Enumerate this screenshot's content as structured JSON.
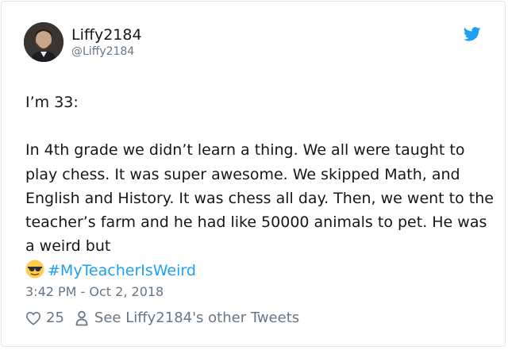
{
  "author": {
    "display_name": "Liffy2184",
    "handle": "@Liffy2184"
  },
  "icons": {
    "platform": "twitter-bird-icon",
    "like": "heart-icon",
    "profile": "person-icon",
    "emoji": "sunglasses-smiley-emoji"
  },
  "colors": {
    "accent": "#1da1f2",
    "text": "#14171a",
    "muted": "#657786"
  },
  "tweet": {
    "intro": "I’m 33:",
    "body": "In 4th grade we didn’t learn a thing. We all were taught to play chess. It was super awesome. We skipped Math, and English and History. It was chess all day. Then, we went to the teacher’s farm and he had like 50000 animals to pet. He was a weird but",
    "hashtag": "#MyTeacherIsWeird",
    "timestamp": "3:42 PM - Oct 2, 2018"
  },
  "footer": {
    "like_count": "25",
    "profile_link": "See Liffy2184's other Tweets"
  }
}
